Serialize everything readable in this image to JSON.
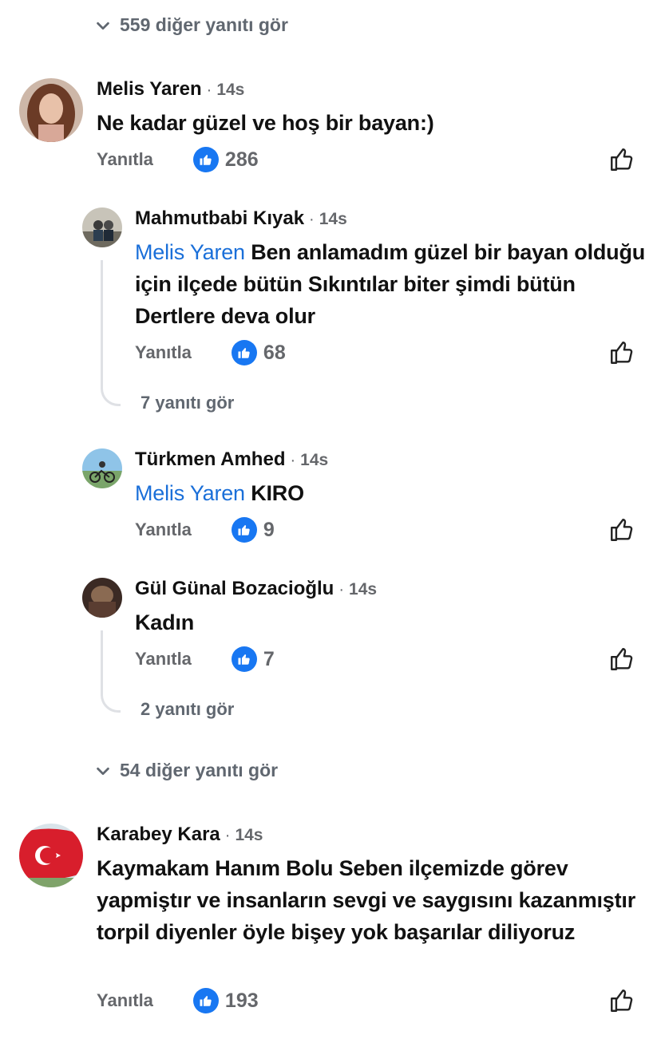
{
  "top_more": {
    "label": "559 diğer yanıtı gör"
  },
  "comments": [
    {
      "name": "Melis Yaren",
      "time": "14s",
      "text": "Ne kadar güzel ve hoş bir bayan:)",
      "reply": "Yanıtla",
      "likes": "286"
    },
    {
      "name": "Mahmutbabi Kıyak",
      "time": "14s",
      "mention": "Melis Yaren",
      "text": "Ben anlamadım güzel bir bayan olduğu için ilçede bütün Sıkıntılar biter şimdi bütün Dertlere deva olur",
      "reply": "Yanıtla",
      "likes": "68",
      "more_replies": "7 yanıtı gör"
    },
    {
      "name": "Türkmen Amhed",
      "time": "14s",
      "mention": "Melis Yaren",
      "text": "KIRO",
      "reply": "Yanıtla",
      "likes": "9"
    },
    {
      "name": "Gül Günal Bozacioğlu",
      "time": "14s",
      "text": "Kadın",
      "reply": "Yanıtla",
      "likes": "7",
      "more_replies": "2 yanıtı gör"
    },
    {
      "name": "Karabey Kara",
      "time": "14s",
      "text": "Kaymakam Hanım Bolu Seben ilçemizde görev yapmiştır ve insanların sevgi ve saygısını kazanmıştır torpil diyenler öyle bişey yok başarılar diliyoruz",
      "reply": "Yanıtla",
      "likes": "193"
    }
  ],
  "middle_more": {
    "label": "54 diğer yanıtı gör"
  },
  "separator": "·",
  "colors": {
    "accent": "#1877f2",
    "mention": "#1a6fd9",
    "muted": "#65676b"
  }
}
